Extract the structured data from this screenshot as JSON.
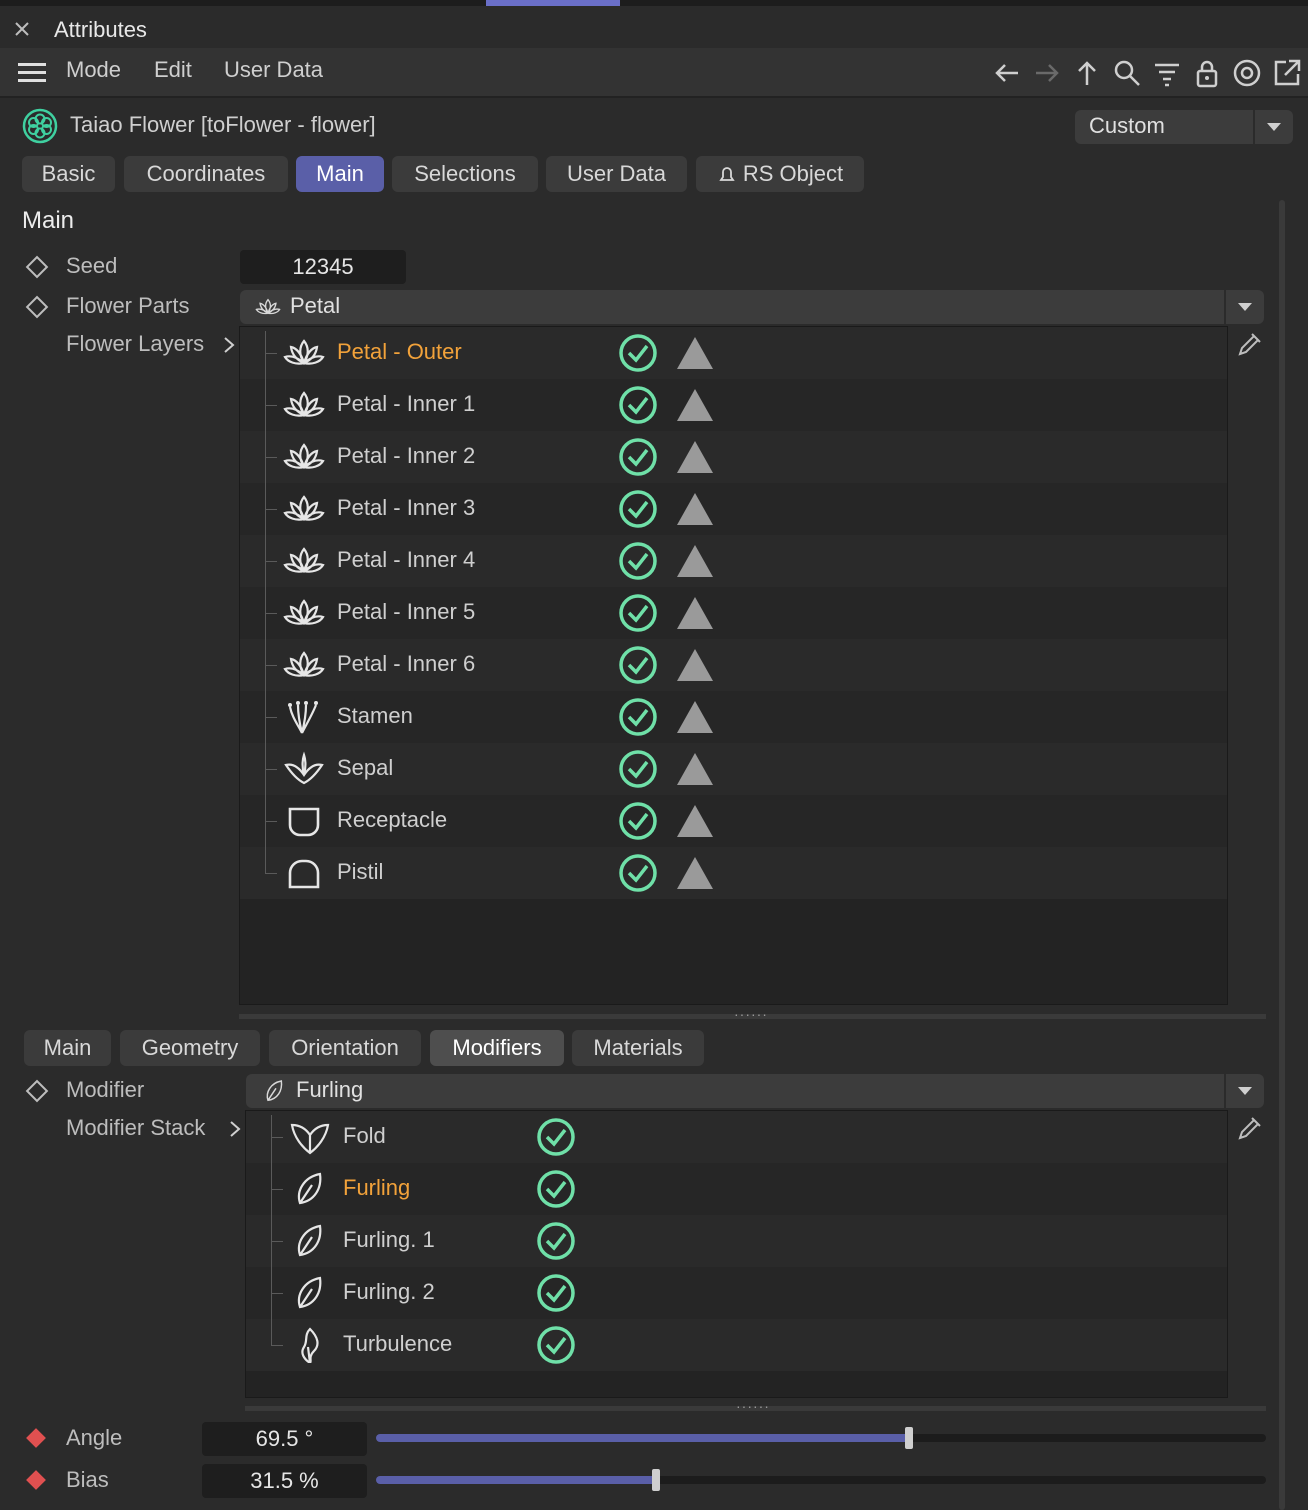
{
  "panel": {
    "title": "Attributes",
    "close_icon": "close-icon"
  },
  "menu": {
    "items": [
      "Mode",
      "Edit",
      "User Data"
    ]
  },
  "toolbar_icons": [
    "arrow-left-icon",
    "arrow-right-icon",
    "arrow-up-icon",
    "search-icon",
    "filter-icon",
    "lock-icon",
    "target-icon",
    "new-window-icon"
  ],
  "object": {
    "name": "Taiao Flower [toFlower - flower]",
    "mode_value": "Custom"
  },
  "tabs": [
    "Basic",
    "Coordinates",
    "Main",
    "Selections",
    "User Data",
    "RS Object"
  ],
  "active_tab": "Main",
  "section_title": "Main",
  "fields": {
    "seed_label": "Seed",
    "seed_value": "12345",
    "flower_parts_label": "Flower Parts",
    "flower_parts_value": "Petal",
    "flower_layers_label": "Flower Layers"
  },
  "flower_layers": [
    {
      "name": "Petal - Outer",
      "icon": "lotus-icon",
      "selected": true
    },
    {
      "name": "Petal - Inner 1",
      "icon": "lotus-icon",
      "selected": false
    },
    {
      "name": "Petal - Inner 2",
      "icon": "lotus-icon",
      "selected": false
    },
    {
      "name": "Petal - Inner 3",
      "icon": "lotus-icon",
      "selected": false
    },
    {
      "name": "Petal - Inner 4",
      "icon": "lotus-icon",
      "selected": false
    },
    {
      "name": "Petal - Inner 5",
      "icon": "lotus-icon",
      "selected": false
    },
    {
      "name": "Petal - Inner 6",
      "icon": "lotus-icon",
      "selected": false
    },
    {
      "name": "Stamen",
      "icon": "stamen-icon",
      "selected": false
    },
    {
      "name": "Sepal",
      "icon": "sepal-icon",
      "selected": false
    },
    {
      "name": "Receptacle",
      "icon": "receptacle-icon",
      "selected": false
    },
    {
      "name": "Pistil",
      "icon": "pistil-icon",
      "selected": false
    }
  ],
  "sub_tabs": [
    "Main",
    "Geometry",
    "Orientation",
    "Modifiers",
    "Materials"
  ],
  "active_sub_tab": "Modifiers",
  "modifier": {
    "label": "Modifier",
    "value": "Furling",
    "stack_label": "Modifier Stack"
  },
  "modifier_stack": [
    {
      "name": "Fold",
      "icon": "fold-icon",
      "selected": false
    },
    {
      "name": "Furling",
      "icon": "leaf-icon",
      "selected": true
    },
    {
      "name": "Furling. 1",
      "icon": "leaf-icon",
      "selected": false
    },
    {
      "name": "Furling. 2",
      "icon": "leaf-icon",
      "selected": false
    },
    {
      "name": "Turbulence",
      "icon": "turbulence-icon",
      "selected": false
    }
  ],
  "params": [
    {
      "label": "Angle",
      "value": "69.5 °",
      "fraction": 0.599
    },
    {
      "label": "Bias",
      "value": "31.5 %",
      "fraction": 0.315
    }
  ],
  "colors": {
    "accent": "#5a5fa8",
    "selected_text": "#f2a23a",
    "check": "#6fe0a8",
    "keyframe": "#e05050"
  }
}
